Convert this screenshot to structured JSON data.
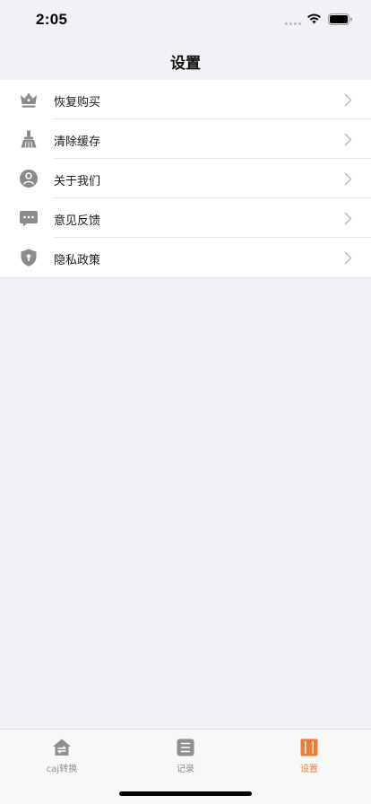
{
  "status_bar": {
    "time": "2:05"
  },
  "nav": {
    "title": "设置"
  },
  "settings": [
    {
      "label": "恢复购买",
      "icon": "crown-icon"
    },
    {
      "label": "清除缓存",
      "icon": "broom-icon"
    },
    {
      "label": "关于我们",
      "icon": "user-circle-icon"
    },
    {
      "label": "意见反馈",
      "icon": "chat-bubble-icon"
    },
    {
      "label": "隐私政策",
      "icon": "shield-lock-icon"
    }
  ],
  "tabs": [
    {
      "label": "caj转换",
      "icon": "home-convert-icon",
      "active": false
    },
    {
      "label": "记录",
      "icon": "records-icon",
      "active": false
    },
    {
      "label": "设置",
      "icon": "settings-book-icon",
      "active": true
    }
  ],
  "colors": {
    "accent": "#f07a37",
    "icon_gray": "#8a8a8f",
    "background": "#f2f1f6"
  }
}
